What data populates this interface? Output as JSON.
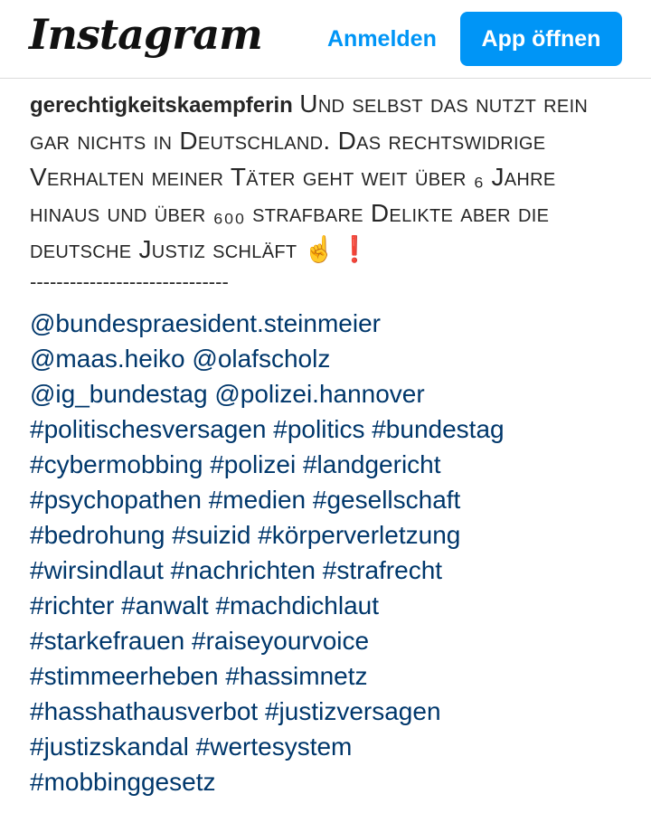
{
  "header": {
    "logo": "Instagram",
    "login_label": "Anmelden",
    "open_app_label": "App öffnen"
  },
  "post": {
    "username": "gerechtigkeitskaempferin",
    "text": "Und selbst das nutzt rein gar nichts in Deutschland. Das rechtswidrige Verhalten meiner Täter geht weit über ₆ Jahre hinaus und über ₆₀₀ strafbare Delikte aber die deutsche Justiz schläft",
    "emojis": "☝️❗",
    "divider": "------------------------------",
    "tags": [
      "@bundespraesident.steinmeier",
      "@maas.heiko",
      "@olafscholz",
      "@ig_bundestag",
      "@polizei.hannover",
      "#politischesversagen",
      "#politics",
      "#bundestag",
      "#cybermobbing",
      "#polizei",
      "#landgericht",
      "#psychopathen",
      "#medien",
      "#gesellschaft",
      "#bedrohung",
      "#suizid",
      "#körperverletzung",
      "#wirsindlaut",
      "#nachrichten",
      "#strafrecht",
      "#richter",
      "#anwalt",
      "#machdichlaut",
      "#starkefrauen",
      "#raiseyourvoice",
      "#stimmeerheben",
      "#hassimnetz",
      "#hasshathausverbot",
      "#justizversagen",
      "#justizskandal",
      "#wertesystem",
      "#mobbinggesetz"
    ]
  }
}
